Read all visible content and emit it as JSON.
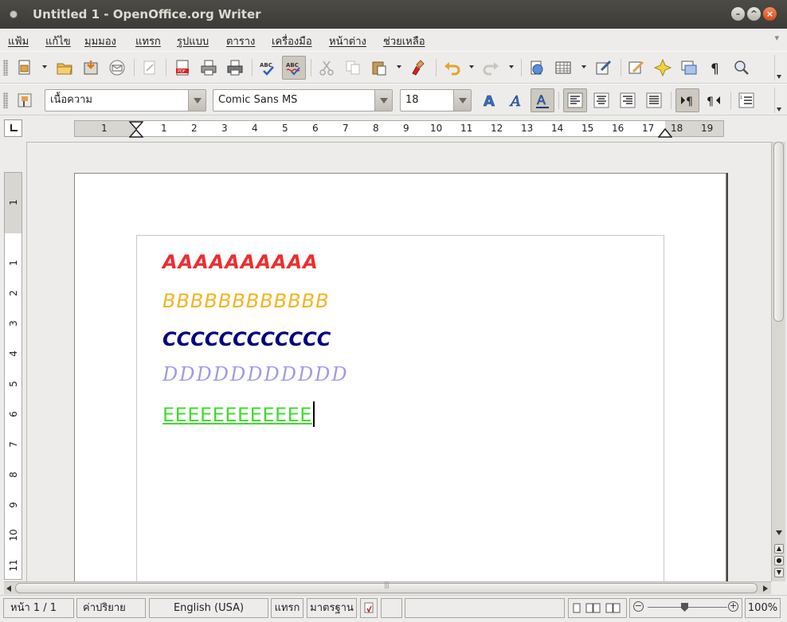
{
  "window": {
    "title": "Untitled 1 - OpenOffice.org Writer"
  },
  "menubar": {
    "items": [
      "แฟ้ม",
      "แก้ไข",
      "มุมมอง",
      "แทรก",
      "รูปแบบ",
      "ตาราง",
      "เครื่องมือ",
      "หน้าต่าง",
      "ช่วยเหลือ"
    ]
  },
  "formatting": {
    "paragraph_style": "เนื้อความ",
    "font_name": "Comic Sans MS",
    "font_size": "18"
  },
  "ruler": {
    "horizontal_ticks": [
      "1",
      "1",
      "2",
      "3",
      "4",
      "5",
      "6",
      "7",
      "8",
      "9",
      "10",
      "11",
      "12",
      "13",
      "14",
      "15",
      "16",
      "17",
      "18",
      "19"
    ],
    "vertical_ticks": [
      "1",
      "1",
      "2",
      "3",
      "4",
      "5",
      "6",
      "7",
      "8",
      "9",
      "10",
      "11"
    ]
  },
  "document": {
    "paragraphs": [
      {
        "text": "AAAAAAAAAA",
        "color": "#ee2d2d"
      },
      {
        "text": "BBBBBBBBBBBB",
        "color": "#f3b521"
      },
      {
        "text": "CCCCCCCCCCCC",
        "color": "#000080"
      },
      {
        "text": "DDDDDDDDDDD",
        "color": "#a09be8"
      },
      {
        "text": "EEEEEEEEEEEE",
        "color": "#3fdc2d"
      }
    ]
  },
  "statusbar": {
    "page": "หน้า 1 / 1",
    "page_style": "ค่าปริยาย",
    "language": "English (USA)",
    "insert_mode": "แทรก",
    "selection_mode": "มาตรฐาน",
    "zoom": "100%"
  }
}
